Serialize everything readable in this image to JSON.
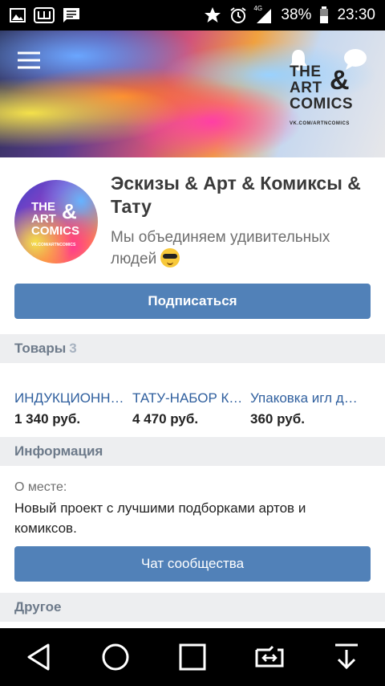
{
  "status_bar": {
    "signal": "4G",
    "battery": "38%",
    "time": "23:30"
  },
  "cover": {
    "logo_lines": [
      "THE",
      "ART",
      "COMICS"
    ],
    "logo_amp": "&",
    "logo_url": "VK.COM/ARTNCOMICS"
  },
  "group": {
    "title": "Эскизы & Арт & Комиксы & Тату",
    "status": "Мы объединяем удивительных людей",
    "subscribe_label": "Подписаться"
  },
  "goods": {
    "label": "Товары",
    "count": "3",
    "items": [
      {
        "name": "ИНДУКЦИОННЫЙ",
        "price": "1 340 руб."
      },
      {
        "name": "ТАТУ-НАБОР КОМПЛЕКТ",
        "price": "4 470 руб."
      },
      {
        "name": "Упаковка игл для тату",
        "price": "360 руб."
      }
    ]
  },
  "info": {
    "label": "Информация",
    "about_label": "О месте:",
    "about_text": "Новый проект с лучшими подборками артов и комиксов.",
    "chat_label": "Чат сообщества"
  },
  "other": {
    "label": "Другое"
  }
}
